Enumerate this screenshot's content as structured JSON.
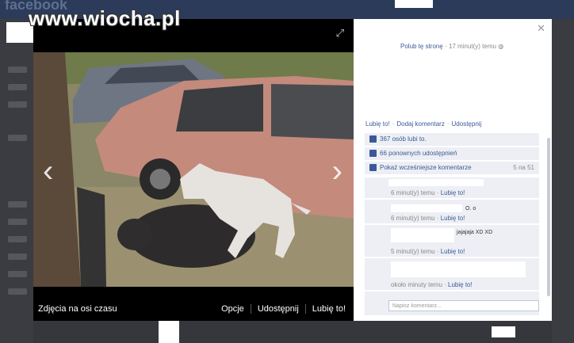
{
  "watermark": "www.wiocha.pl",
  "background": {
    "brand": "facebook"
  },
  "viewer": {
    "album_title": "Zdjęcia na osi czasu",
    "actions": [
      "Opcje",
      "Udostępnij",
      "Lubię to!"
    ]
  },
  "panel": {
    "like_page": "Polub tę stronę",
    "time": "17 minut(y) temu",
    "links": [
      "Lubię to!",
      "Dodaj komentarz",
      "Udostępnij"
    ],
    "likes": "367 osób lubi to.",
    "shares": "66 ponownych udostępnień",
    "show_comments": "Pokaż wcześniejsze komentarze",
    "count": "5 na 51",
    "comments": [
      {
        "text": "",
        "time": "6 minut(y) temu",
        "like": "Lubię to!"
      },
      {
        "text": "O. o",
        "time": "6 minut(y) temu",
        "like": "Lubię to!"
      },
      {
        "text": "jajajaja XD XD",
        "time": "5 minut(y) temu",
        "like": "Lubię to!"
      },
      {
        "text": "",
        "time": "około minuty temu",
        "like": "Lubię to!"
      }
    ],
    "comment_placeholder": "Napisz komentarz..."
  }
}
